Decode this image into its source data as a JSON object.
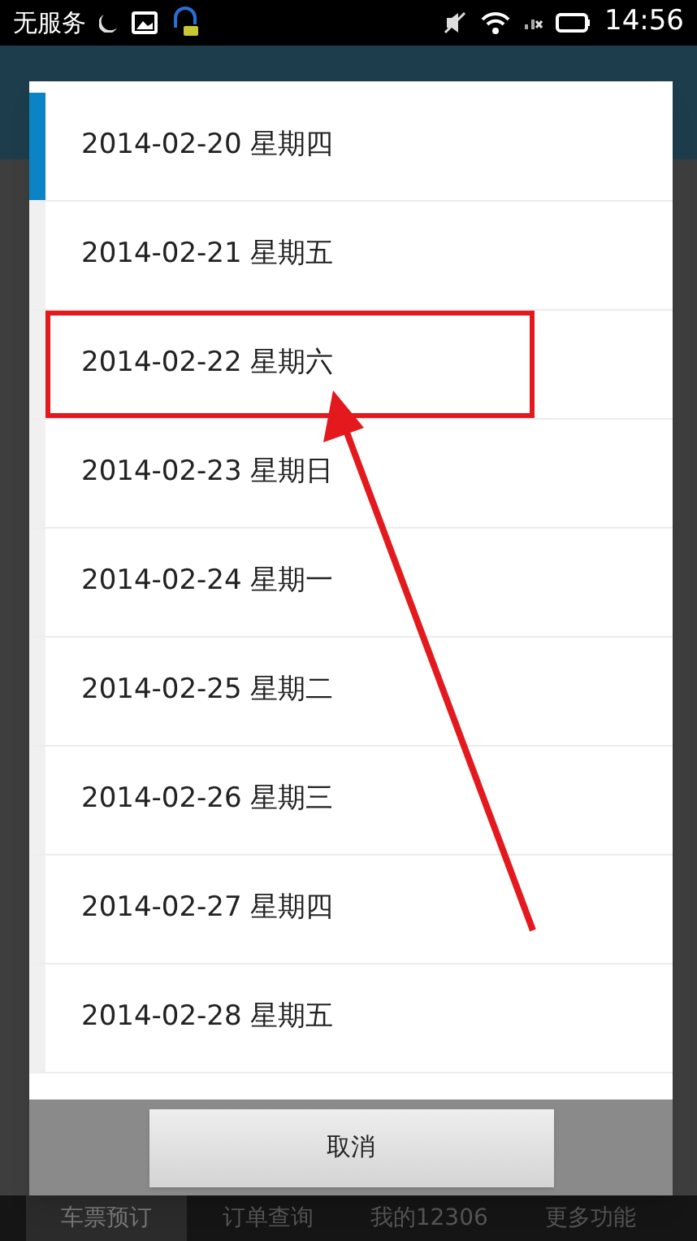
{
  "status_bar": {
    "carrier": "无服务",
    "time": "14:56"
  },
  "dialog": {
    "items": [
      {
        "label": "2014-02-20 星期四",
        "selected": true,
        "highlighted": false
      },
      {
        "label": "2014-02-21 星期五",
        "selected": false,
        "highlighted": false
      },
      {
        "label": "2014-02-22 星期六",
        "selected": false,
        "highlighted": true
      },
      {
        "label": "2014-02-23 星期日",
        "selected": false,
        "highlighted": false
      },
      {
        "label": "2014-02-24 星期一",
        "selected": false,
        "highlighted": false
      },
      {
        "label": "2014-02-25 星期二",
        "selected": false,
        "highlighted": false
      },
      {
        "label": "2014-02-26 星期三",
        "selected": false,
        "highlighted": false
      },
      {
        "label": "2014-02-27 星期四",
        "selected": false,
        "highlighted": false
      },
      {
        "label": "2014-02-28 星期五",
        "selected": false,
        "highlighted": false
      }
    ],
    "cancel": "取消"
  },
  "bottom_tabs": [
    {
      "label": "车票预订",
      "selected": true
    },
    {
      "label": "订单查询",
      "selected": false
    },
    {
      "label": "我的12306",
      "selected": false
    },
    {
      "label": "更多功能",
      "selected": false
    }
  ]
}
